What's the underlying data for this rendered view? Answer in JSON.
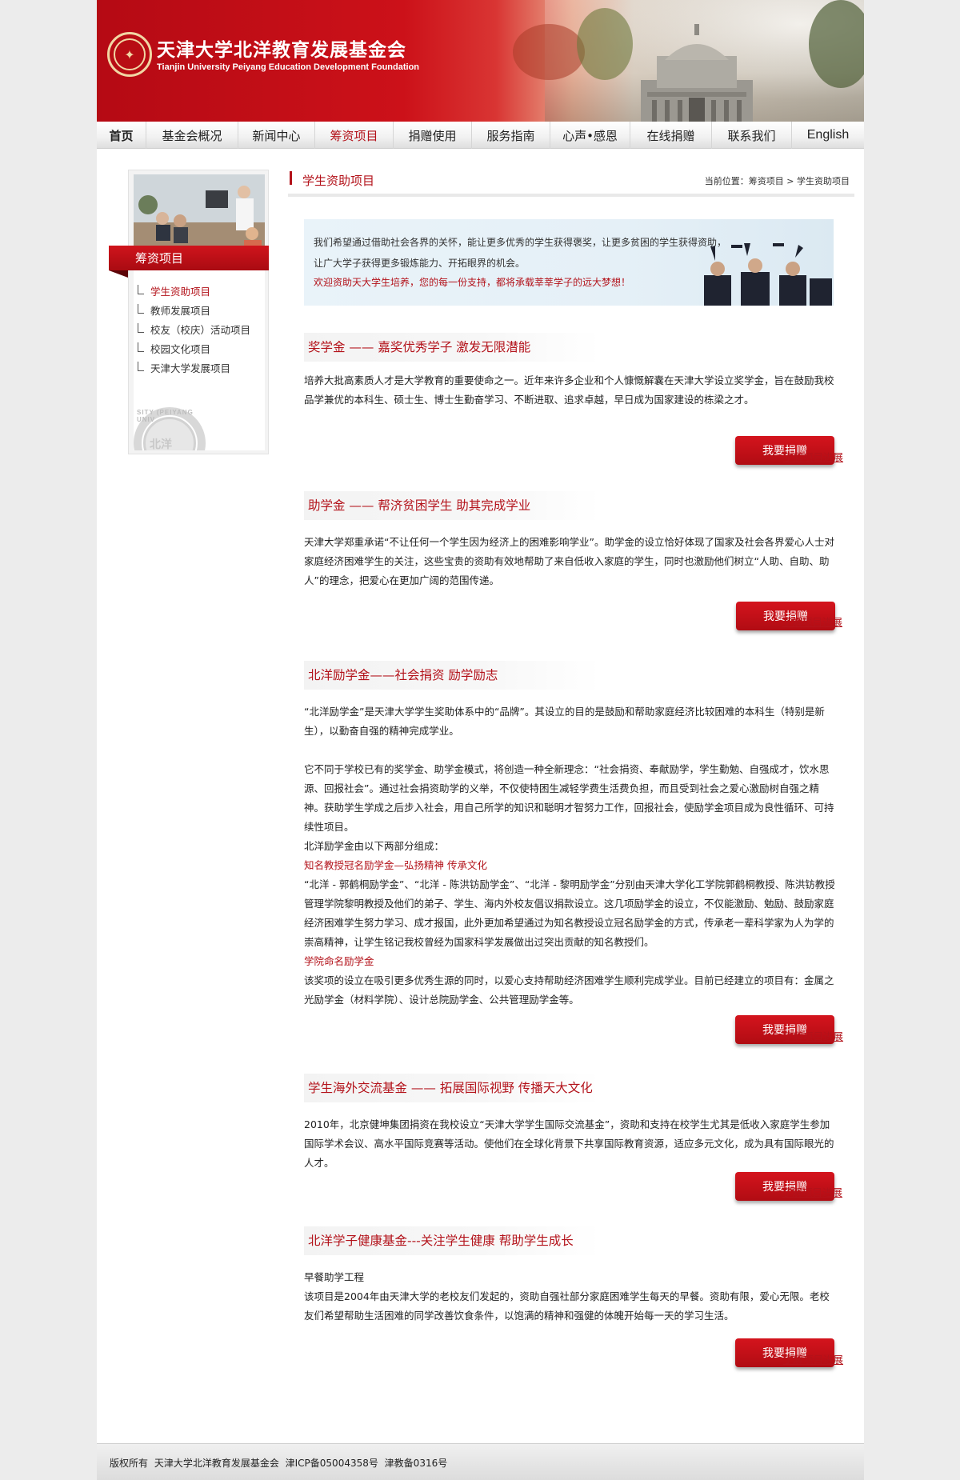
{
  "header": {
    "title": "天津大学北洋教育发展基金会",
    "subtitle": "Tianjin University Peiyang Education Development Foundation"
  },
  "nav": {
    "items": [
      {
        "label": "首页"
      },
      {
        "label": "基金会概况"
      },
      {
        "label": "新闻中心"
      },
      {
        "label": "筹资项目"
      },
      {
        "label": "捐赠使用"
      },
      {
        "label": "服务指南"
      },
      {
        "label": "心声•感恩"
      },
      {
        "label": "在线捐赠"
      },
      {
        "label": "联系我们"
      },
      {
        "label": "English"
      }
    ],
    "current": "筹资项目"
  },
  "sidebar": {
    "header": "筹资项目",
    "items": [
      {
        "label": "学生资助项目"
      },
      {
        "label": "教师发展项目"
      },
      {
        "label": "校友（校庆）活动项目"
      },
      {
        "label": "校园文化项目"
      },
      {
        "label": "天津大学发展项目"
      }
    ],
    "seal_arc": "SITY (PEIYANG UNIV",
    "seal_text": "北洋"
  },
  "main": {
    "page_title": "学生资助项目",
    "location": "当前位置：筹资项目 > 学生资助项目",
    "banner": {
      "line1": "我们希望通过借助社会各界的关怀，能让更多优秀的学生获得褒奖，让更多贫困的学生获得资助，",
      "line2": "让广大学子获得更多锻炼能力、开拓眼界的机会。",
      "line3": "欢迎资助天大学生培养，您的每一份支持，都将承载莘莘学子的远大梦想！"
    },
    "donate_label": "我要捐赠",
    "progress_label": "了解项目进展",
    "sections": [
      {
        "title": "奖学金 —— 嘉奖优秀学子 激发无限潜能",
        "p1": "培养大批高素质人才是大学教育的重要使命之一。近年来许多企业和个人慷慨解囊在天津大学设立奖学金，旨在鼓励我校品学兼优的本科生、硕士生、博士生勤奋学习、不断进取、追求卓越，早日成为国家建设的栋梁之才。"
      },
      {
        "title": "助学金 —— 帮济贫困学生 助其完成学业",
        "p1": "天津大学郑重承诺“不让任何一个学生因为经济上的困难影响学业”。助学金的设立恰好体现了国家及社会各界爱心人士对家庭经济困难学生的关注，这些宝贵的资助有效地帮助了来自低收入家庭的学生，同时也激励他们树立“人助、自助、助人”的理念，把爱心在更加广阔的范围传递。"
      },
      {
        "title": "北洋励学金——社会捐资  励学励志",
        "p1": "“北洋励学金”是天津大学学生奖助体系中的“品牌”。其设立的目的是鼓励和帮助家庭经济比较困难的本科生（特别是新生），以勤奋自强的精神完成学业。",
        "p2": "它不同于学校已有的奖学金、助学金模式，将创造一种全新理念：“社会捐资、奉献励学，学生勤勉、自强成才，饮水思源、回报社会”。通过社会捐资助学的义举，不仅使特困生减轻学费生活费负担，而且受到社会之爱心激励树自强之精神。获助学生学成之后步入社会，用自己所学的知识和聪明才智努力工作，回报社会，使励学金项目成为良性循环、可持续性项目。",
        "p3": "北洋励学金由以下两部分组成：",
        "sub1_title": "知名教授冠名励学金—弘扬精神 传承文化",
        "sub1_text": "“北洋 - 郭鹤桐励学金”、“北洋 - 陈洪钫励学金”、“北洋 - 黎明励学金”分别由天津大学化工学院郭鹤桐教授、陈洪钫教授管理学院黎明教授及他们的弟子、学生、海内外校友倡议捐款设立。这几项励学金的设立，不仅能激励、勉励、鼓励家庭经济困难学生努力学习、成才报国，此外更加希望通过为知名教授设立冠名励学金的方式，传承老一辈科学家为人为学的崇高精神，让学生铭记我校曾经为国家科学发展做出过突出贡献的知名教授们。",
        "sub2_title": "学院命名励学金",
        "sub2_text": "该奖项的设立在吸引更多优秀生源的同时，以爱心支持帮助经济困难学生顺利完成学业。目前已经建立的项目有：金属之光励学金（材料学院）、设计总院励学金、公共管理励学金等。"
      },
      {
        "title": "学生海外交流基金 —— 拓展国际视野 传播天大文化",
        "p1": "2010年，北京健坤集团捐资在我校设立“天津大学学生国际交流基金”，资助和支持在校学生尤其是低收入家庭学生参加国际学术会议、高水平国际竞赛等活动。使他们在全球化背景下共享国际教育资源，适应多元文化，成为具有国际眼光的人才。"
      },
      {
        "title": "北洋学子健康基金---关注学生健康 帮助学生成长",
        "sub_title": "早餐助学工程",
        "p1": "该项目是2004年由天津大学的老校友们发起的，资助自强社部分家庭困难学生每天的早餐。资助有限，爱心无限。老校友们希望帮助生活困难的同学改善饮食条件，以饱满的精神和强健的体魄开始每一天的学习生活。"
      }
    ]
  },
  "footer": {
    "text": "版权所有 天津大学北洋教育发展基金会  津ICP备05004358号  津教备0316号"
  },
  "colors": {
    "brand_red": "#b3121a",
    "header_red": "#cc1119"
  }
}
